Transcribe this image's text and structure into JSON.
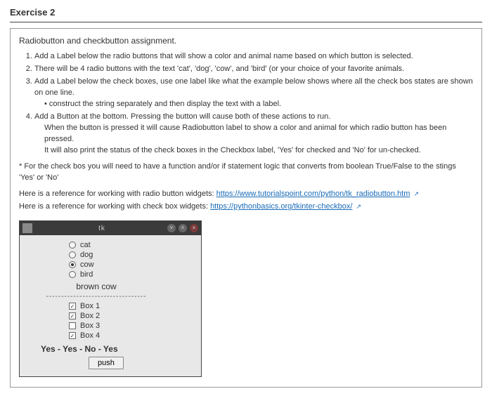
{
  "heading": "Exercise 2",
  "intro": "Radiobutton and checkbutton assignment.",
  "steps": {
    "s1": "Add a Label below the radio buttons that will show a color and animal name based on which button is selected.",
    "s2": "There will be 4 radio buttons with the text 'cat', 'dog', 'cow', and 'bird' (or your choice of your favorite animals.",
    "s3": "Add a Label below the check boxes, use one label like what the example below shows where all the check bos states are shown on one line.",
    "s3sub": "construct the string separately and then display the text with a label.",
    "s4": "Add a Button at the bottom. Pressing the button will cause both of these actions to run.",
    "s4a": "When the button is pressed it will cause Radiobutton label to show a color and animal for which radio button has been pressed.",
    "s4b": "It will also print the status of the check boxes in the Checkbox label, 'Yes' for checked and 'No' for un-checked."
  },
  "note": "* For the check bos you will need to have a function and/or if statement logic that converts from boolean True/False to the stings 'Yes' or 'No'",
  "ref1_text": "Here is a reference for working with radio button widgets: ",
  "ref1_link": "https://www.tutorialspoint.com/python/tk_radiobutton.htm",
  "ref2_text": "Here is a reference for working with check box widgets: ",
  "ref2_link": "https://pythonbasics.org/tkinter-checkbox/",
  "app": {
    "title": "tk",
    "radios": {
      "r1": "cat",
      "r2": "dog",
      "r3": "cow",
      "r4": "bird"
    },
    "radio_result": "brown cow",
    "separator": "---------------------------------",
    "checks": {
      "c1": "Box 1",
      "c2": "Box 2",
      "c3": "Box 3",
      "c4": "Box 4"
    },
    "check_result": "Yes - Yes - No - Yes",
    "button": "push"
  }
}
